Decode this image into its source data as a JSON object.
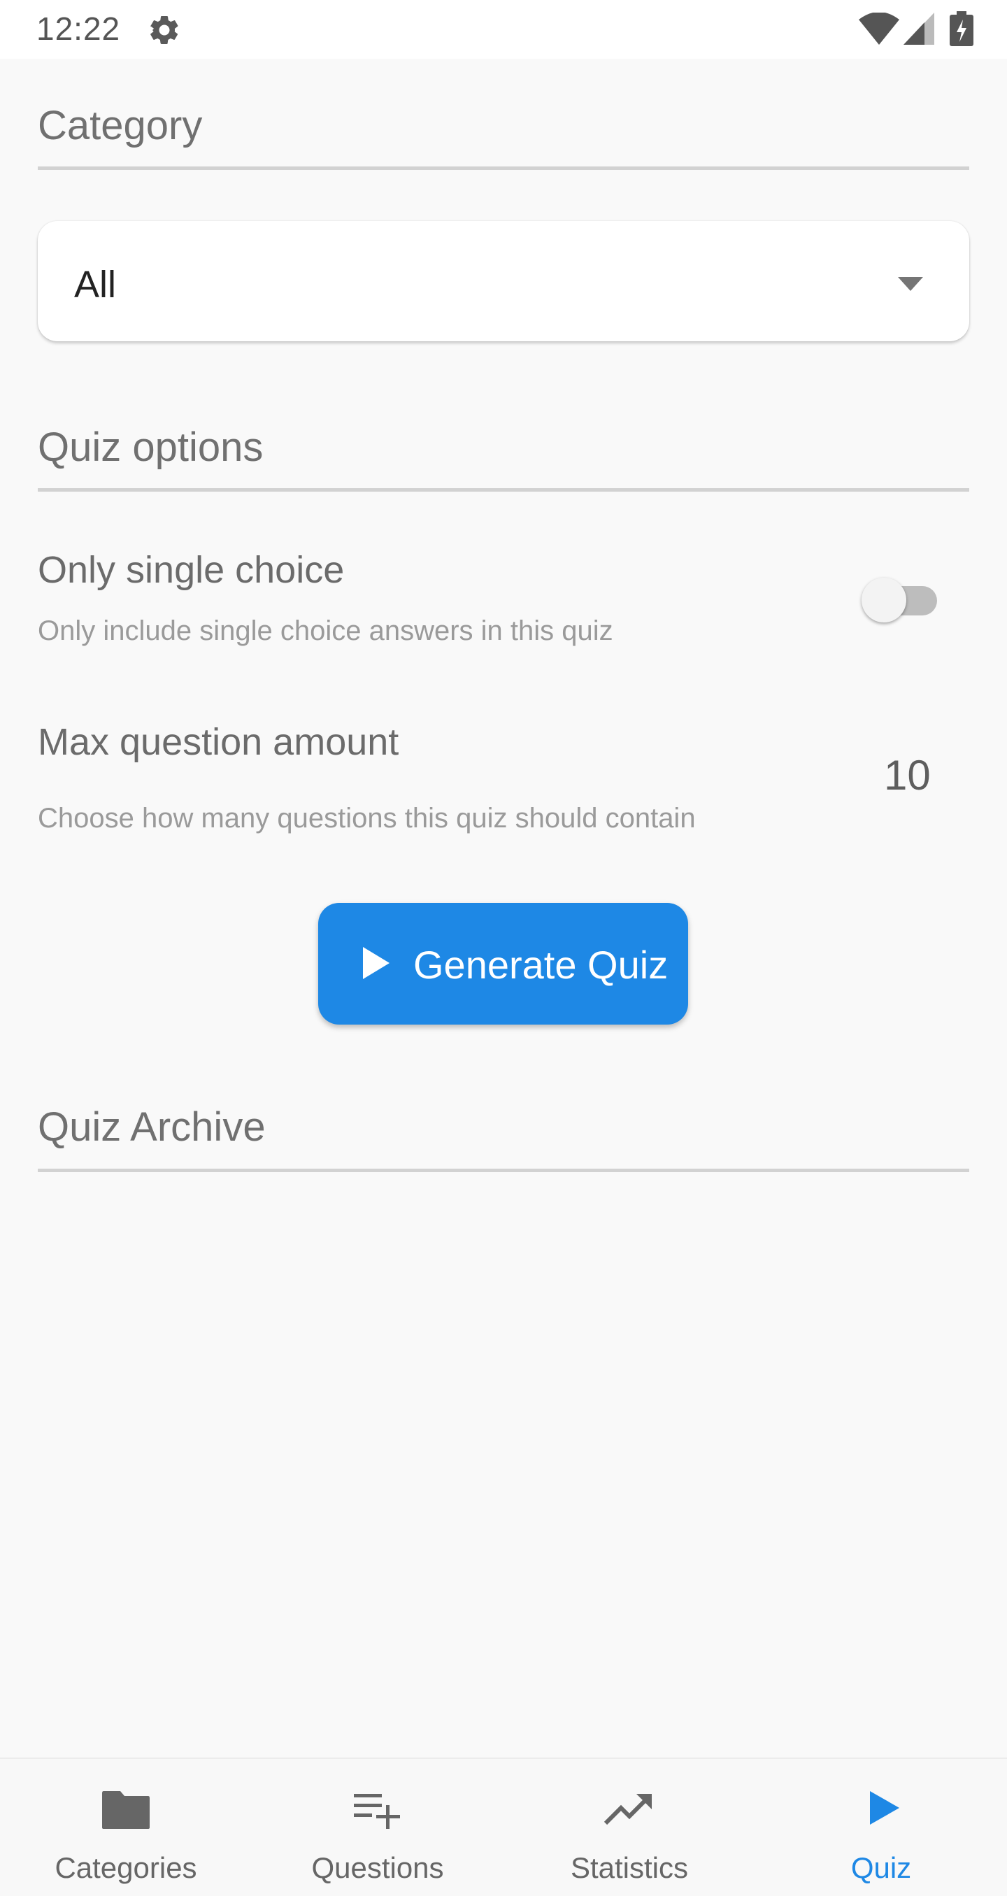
{
  "status_bar": {
    "time": "12:22",
    "icons": [
      "gear-icon",
      "wifi-icon",
      "signal-icon",
      "battery-charging-icon"
    ]
  },
  "category_section": {
    "title": "Category",
    "dropdown": {
      "selected": "All",
      "icon": "dropdown-arrow-icon"
    }
  },
  "quiz_options": {
    "title": "Quiz options",
    "single_choice": {
      "title": "Only single choice",
      "subtitle": "Only include single choice answers in this quiz",
      "enabled": false
    },
    "max_questions": {
      "title": "Max question amount",
      "subtitle": "Choose how many questions this quiz should contain",
      "value": "10"
    }
  },
  "generate_button": {
    "label": "Generate Quiz",
    "icon": "play-icon"
  },
  "archive_section": {
    "title": "Quiz Archive"
  },
  "bottom_nav": {
    "items": [
      {
        "label": "Categories",
        "icon": "folder-icon",
        "active": false
      },
      {
        "label": "Questions",
        "icon": "playlist-add-icon",
        "active": false
      },
      {
        "label": "Statistics",
        "icon": "trending-up-icon",
        "active": false
      },
      {
        "label": "Quiz",
        "icon": "play-icon",
        "active": true
      }
    ]
  },
  "colors": {
    "accent": "#1e88e5",
    "background": "#f9f9f9",
    "toggle_off": "#bdbdbd"
  }
}
